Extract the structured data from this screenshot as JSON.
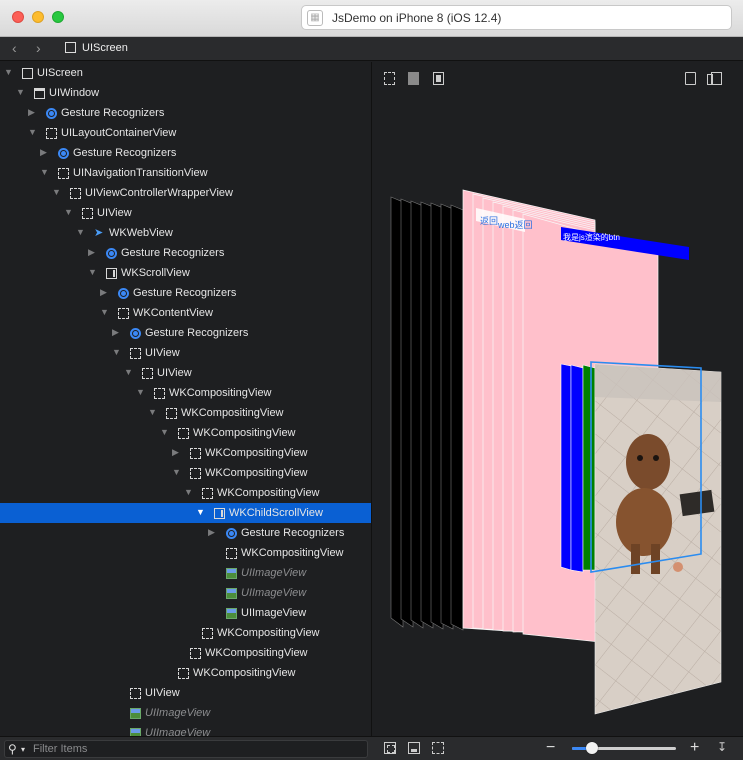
{
  "window": {
    "scheme_title": "JsDemo on iPhone 8 (iOS 12.4)",
    "scheme_icon": "app-icon"
  },
  "navbar": {
    "back_icon": "chevron-left-icon",
    "forward_icon": "chevron-right-icon",
    "breadcrumb": "UIScreen"
  },
  "tree": [
    {
      "label": "UIScreen",
      "icon": "screen",
      "depth": 0,
      "disclosure": "open",
      "dim": false,
      "selected": false
    },
    {
      "label": "UIWindow",
      "icon": "window",
      "depth": 1,
      "disclosure": "open",
      "dim": false,
      "selected": false
    },
    {
      "label": "Gesture Recognizers",
      "icon": "gesture",
      "depth": 2,
      "disclosure": "closed",
      "dim": false,
      "selected": false
    },
    {
      "label": "UILayoutContainerView",
      "icon": "view",
      "depth": 2,
      "disclosure": "open",
      "dim": false,
      "selected": false
    },
    {
      "label": "Gesture Recognizers",
      "icon": "gesture",
      "depth": 3,
      "disclosure": "closed",
      "dim": false,
      "selected": false
    },
    {
      "label": "UINavigationTransitionView",
      "icon": "view",
      "depth": 3,
      "disclosure": "open",
      "dim": false,
      "selected": false
    },
    {
      "label": "UIViewControllerWrapperView",
      "icon": "view",
      "depth": 4,
      "disclosure": "open",
      "dim": false,
      "selected": false
    },
    {
      "label": "UIView",
      "icon": "view",
      "depth": 5,
      "disclosure": "open",
      "dim": false,
      "selected": false
    },
    {
      "label": "WKWebView",
      "icon": "compass",
      "depth": 6,
      "disclosure": "open",
      "dim": false,
      "selected": false
    },
    {
      "label": "Gesture Recognizers",
      "icon": "gesture",
      "depth": 7,
      "disclosure": "closed",
      "dim": false,
      "selected": false
    },
    {
      "label": "WKScrollView",
      "icon": "scroll",
      "depth": 7,
      "disclosure": "open",
      "dim": false,
      "selected": false
    },
    {
      "label": "Gesture Recognizers",
      "icon": "gesture",
      "depth": 8,
      "disclosure": "closed",
      "dim": false,
      "selected": false
    },
    {
      "label": "WKContentView",
      "icon": "view",
      "depth": 8,
      "disclosure": "open",
      "dim": false,
      "selected": false
    },
    {
      "label": "Gesture Recognizers",
      "icon": "gesture",
      "depth": 9,
      "disclosure": "closed",
      "dim": false,
      "selected": false
    },
    {
      "label": "UIView",
      "icon": "view",
      "depth": 9,
      "disclosure": "open",
      "dim": false,
      "selected": false
    },
    {
      "label": "UIView",
      "icon": "view",
      "depth": 10,
      "disclosure": "open",
      "dim": false,
      "selected": false
    },
    {
      "label": "WKCompositingView",
      "icon": "view",
      "depth": 11,
      "disclosure": "open",
      "dim": false,
      "selected": false
    },
    {
      "label": "WKCompositingView",
      "icon": "view",
      "depth": 12,
      "disclosure": "open",
      "dim": false,
      "selected": false
    },
    {
      "label": "WKCompositingView",
      "icon": "view",
      "depth": 13,
      "disclosure": "open",
      "dim": false,
      "selected": false
    },
    {
      "label": "WKCompositingView",
      "icon": "view",
      "depth": 14,
      "disclosure": "closed",
      "dim": false,
      "selected": false
    },
    {
      "label": "WKCompositingView",
      "icon": "view",
      "depth": 14,
      "disclosure": "open",
      "dim": false,
      "selected": false
    },
    {
      "label": "WKCompositingView",
      "icon": "view",
      "depth": 15,
      "disclosure": "open",
      "dim": false,
      "selected": false
    },
    {
      "label": "WKChildScrollView",
      "icon": "scroll",
      "depth": 16,
      "disclosure": "open",
      "dim": false,
      "selected": true
    },
    {
      "label": "Gesture Recognizers",
      "icon": "gesture",
      "depth": 17,
      "disclosure": "closed",
      "dim": false,
      "selected": false
    },
    {
      "label": "WKCompositingView",
      "icon": "view",
      "depth": 17,
      "disclosure": "none",
      "dim": false,
      "selected": false
    },
    {
      "label": "UIImageView",
      "icon": "image",
      "depth": 17,
      "disclosure": "none",
      "dim": true,
      "selected": false
    },
    {
      "label": "UIImageView",
      "icon": "image",
      "depth": 17,
      "disclosure": "none",
      "dim": true,
      "selected": false
    },
    {
      "label": "UIImageView",
      "icon": "image",
      "depth": 17,
      "disclosure": "none",
      "dim": false,
      "selected": false
    },
    {
      "label": "WKCompositingView",
      "icon": "view",
      "depth": 15,
      "disclosure": "none",
      "dim": false,
      "selected": false
    },
    {
      "label": "WKCompositingView",
      "icon": "view",
      "depth": 14,
      "disclosure": "none",
      "dim": false,
      "selected": false
    },
    {
      "label": "WKCompositingView",
      "icon": "view",
      "depth": 13,
      "disclosure": "none",
      "dim": false,
      "selected": false
    },
    {
      "label": "UIView",
      "icon": "view",
      "depth": 9,
      "disclosure": "none",
      "dim": false,
      "selected": false
    },
    {
      "label": "UIImageView",
      "icon": "image",
      "depth": 9,
      "disclosure": "none",
      "dim": true,
      "selected": false
    },
    {
      "label": "UIImageView",
      "icon": "image",
      "depth": 9,
      "disclosure": "none",
      "dim": true,
      "selected": false
    }
  ],
  "canvas": {
    "toolbar_icons": [
      "show-clipped-icon",
      "show-wireframe-icon",
      "show-contents-icon",
      "device-frame-icon",
      "split-view-icon"
    ],
    "labels": {
      "nav_left": "返回",
      "nav_right": "web返回",
      "banner": "我是js渲染的btn"
    },
    "colors": {
      "pink": "#ffc0cb",
      "blue": "#0000ff",
      "green": "#008000",
      "highlight": "#2a8cf0"
    }
  },
  "bottombar": {
    "filter_icon": "search-icon",
    "filter_placeholder": "Filter Items",
    "toggle_icons": [
      "reset-view-icon",
      "adjust-view-icon",
      "clip-icon"
    ],
    "zoom_level": 0.19,
    "export_icon": "export-icon"
  }
}
